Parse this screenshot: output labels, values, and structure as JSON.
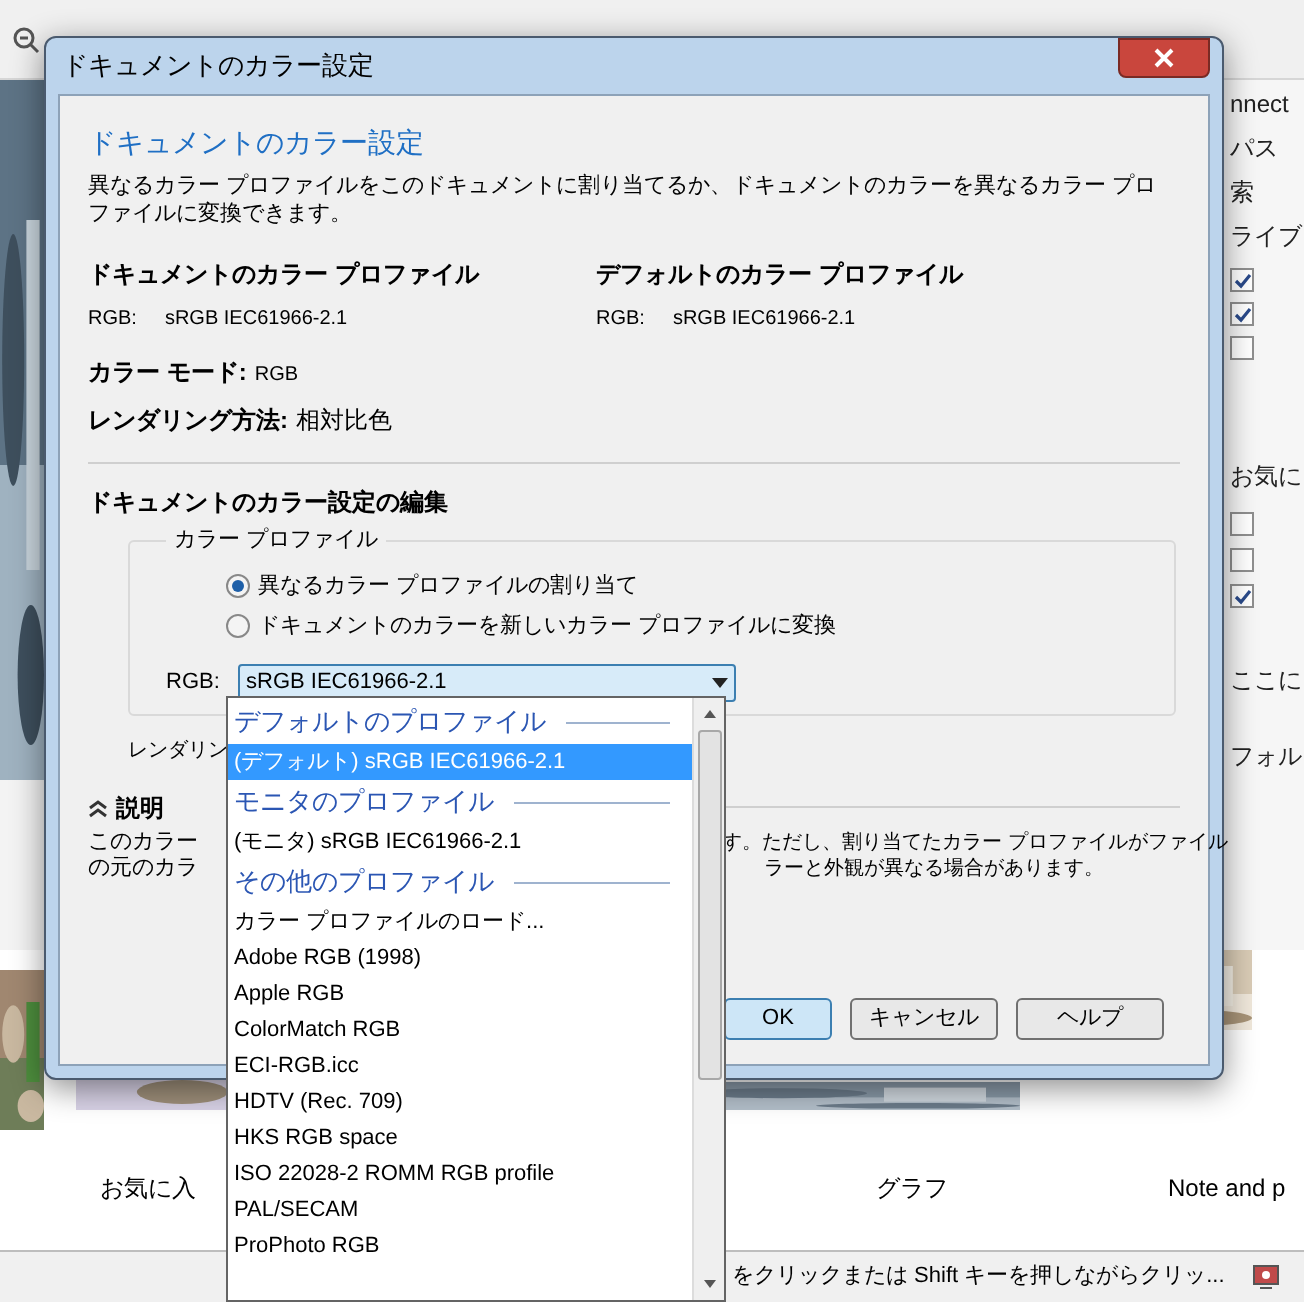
{
  "app": {
    "right_panel": [
      {
        "kind": "text",
        "label": "nnect"
      },
      {
        "kind": "text",
        "label": "パス"
      },
      {
        "kind": "text",
        "label": "索"
      },
      {
        "kind": "text",
        "label": "ライブ"
      },
      {
        "kind": "checkbox",
        "checked": true
      },
      {
        "kind": "checkbox",
        "checked": true
      },
      {
        "kind": "checkbox",
        "checked": false
      },
      {
        "kind": "text",
        "label": "お気に"
      },
      {
        "kind": "checkbox",
        "checked": false
      },
      {
        "kind": "checkbox",
        "checked": false
      },
      {
        "kind": "checkbox",
        "checked": true
      },
      {
        "kind": "text",
        "label": "ここに"
      },
      {
        "kind": "text",
        "label": "フォル"
      }
    ],
    "thumbnails": [
      "お気に入",
      "グラフ",
      "Note and p"
    ],
    "status": "をクリックまたは Shift キーを押しながらクリッ..."
  },
  "dialog": {
    "title": "ドキュメントのカラー設定",
    "heading": "ドキュメントのカラー設定",
    "intro": "異なるカラー プロファイルをこのドキュメントに割り当てるか、ドキュメントのカラーを異なるカラー プロファイルに変換できます。",
    "profiles": [
      {
        "title": "ドキュメントのカラー プロファイル",
        "label": "RGB:",
        "value": "sRGB IEC61966-2.1"
      },
      {
        "title": "デフォルトのカラー プロファイル",
        "label": "RGB:",
        "value": "sRGB IEC61966-2.1"
      }
    ],
    "color_mode": {
      "label": "カラー モード:",
      "value": "RGB"
    },
    "rendering": {
      "label": "レンダリング方法:",
      "value": "相対比色"
    },
    "edit_heading": "ドキュメントのカラー設定の編集",
    "group_title": "カラー プロファイル",
    "radios": [
      {
        "label": "異なるカラー プロファイルの割り当て",
        "selected": true
      },
      {
        "label": "ドキュメントのカラーを新しいカラー プロファイルに変換",
        "selected": false
      }
    ],
    "select": {
      "label": "RGB:",
      "value": "sRGB IEC61966-2.1"
    },
    "rendering_edit_label": "レンダリン",
    "explanation": {
      "title": "説明",
      "expanded": true,
      "lines": [
        {
          "left": "このカラー",
          "right": "す。ただし、割り当てたカラー プロファイルがファイル"
        },
        {
          "left": "の元のカラ",
          "right": "ラーと外観が異なる場合があります。"
        }
      ]
    },
    "buttons": [
      {
        "label": "OK",
        "default": true
      },
      {
        "label": "キャンセル",
        "default": false
      },
      {
        "label": "ヘルプ",
        "default": false
      }
    ]
  },
  "dropdown": {
    "items": [
      {
        "kind": "header",
        "label": "デフォルトのプロファイル"
      },
      {
        "kind": "item",
        "label": "(デフォルト) sRGB IEC61966-2.1",
        "selected": true
      },
      {
        "kind": "header",
        "label": "モニタのプロファイル"
      },
      {
        "kind": "item",
        "label": "(モニタ) sRGB IEC61966-2.1",
        "selected": false
      },
      {
        "kind": "header",
        "label": "その他のプロファイル"
      },
      {
        "kind": "item",
        "label": "カラー プロファイルのロード...",
        "selected": false
      },
      {
        "kind": "item",
        "label": "Adobe RGB (1998)",
        "selected": false
      },
      {
        "kind": "item",
        "label": "Apple RGB",
        "selected": false
      },
      {
        "kind": "item",
        "label": "ColorMatch RGB",
        "selected": false
      },
      {
        "kind": "item",
        "label": "ECI-RGB.icc",
        "selected": false
      },
      {
        "kind": "item",
        "label": "HDTV (Rec. 709)",
        "selected": false
      },
      {
        "kind": "item",
        "label": "HKS RGB space",
        "selected": false
      },
      {
        "kind": "item",
        "label": "ISO 22028-2 ROMM RGB profile",
        "selected": false
      },
      {
        "kind": "item",
        "label": "PAL/SECAM",
        "selected": false
      },
      {
        "kind": "item",
        "label": "ProPhoto RGB",
        "selected": false
      }
    ]
  }
}
